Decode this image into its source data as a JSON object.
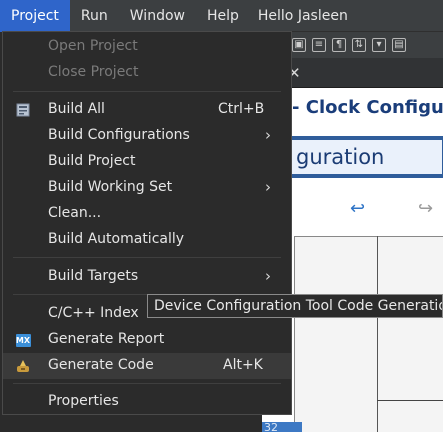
{
  "menubar": {
    "items": [
      "Project",
      "Run",
      "Window",
      "Help"
    ],
    "active": "Project",
    "user_label": "Hello Jasleen"
  },
  "editor": {
    "title_fragment": "- Clock Configura",
    "banner_fragment": "guration",
    "canvas_value": "32"
  },
  "project_menu": {
    "items": [
      {
        "label": "Open Project",
        "disabled": true
      },
      {
        "label": "Close Project",
        "disabled": true
      },
      {
        "label": "Build All",
        "shortcut": "Ctrl+B",
        "icon": "build-all-icon"
      },
      {
        "label": "Build Configurations",
        "submenu": true
      },
      {
        "label": "Build Project"
      },
      {
        "label": "Build Working Set",
        "submenu": true
      },
      {
        "label": "Clean..."
      },
      {
        "label": "Build Automatically"
      },
      {
        "label": "Build Targets",
        "submenu": true
      },
      {
        "label": "C/C++ Index"
      },
      {
        "label": "Generate Report",
        "icon": "mx-report-icon"
      },
      {
        "label": "Generate Code",
        "shortcut": "Alt+K",
        "icon": "generate-code-icon",
        "hovered": true
      },
      {
        "label": "Properties"
      }
    ],
    "submenu_arrow": "›",
    "mx_icon_text": "MX"
  },
  "tooltip": {
    "text": "Device Configuration Tool Code Generation"
  },
  "colors": {
    "menubar_bg": "#3c3f41",
    "active_menu_bg": "#2f65ca",
    "menu_bg": "#2b2b2b",
    "disabled_text": "#7a7a7a",
    "accent_blue": "#2f5d9b"
  }
}
